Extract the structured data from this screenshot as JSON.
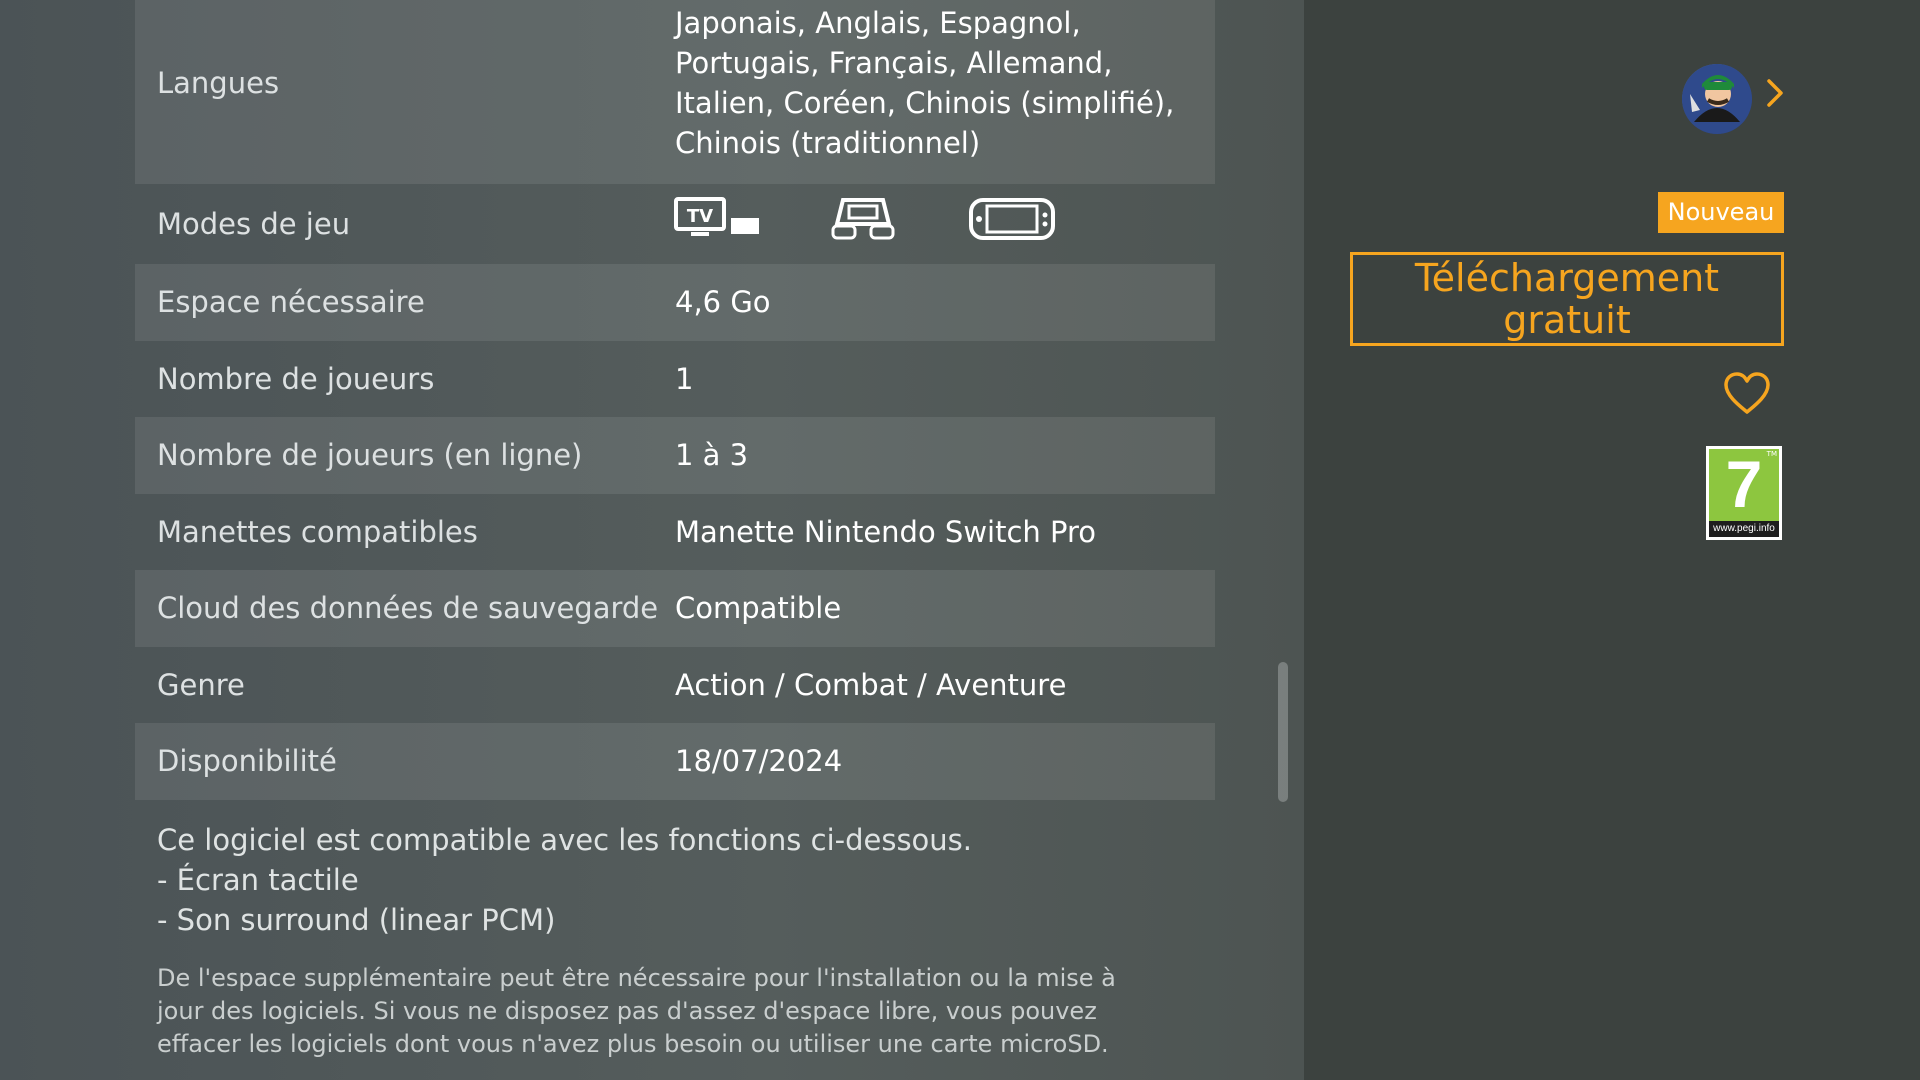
{
  "details": {
    "langues": {
      "label": "Langues",
      "lines": [
        "Japonais, Anglais, Espagnol,",
        "Portugais, Français, Allemand,",
        "Italien, Coréen, Chinois (simplifié),",
        "Chinois (traditionnel)"
      ]
    },
    "modes": {
      "label": "Modes de jeu",
      "icons": [
        "tv-mode-icon",
        "tabletop-mode-icon",
        "handheld-mode-icon"
      ],
      "tv_text": "TV"
    },
    "rows": [
      {
        "label": "Espace nécessaire",
        "value": "4,6 Go"
      },
      {
        "label": "Nombre de joueurs",
        "value": "1"
      },
      {
        "label": "Nombre de joueurs (en ligne)",
        "value": "1 à 3"
      },
      {
        "label": "Manettes compatibles",
        "value": "Manette Nintendo Switch Pro"
      },
      {
        "label": "Cloud des données de sauvegarde",
        "value": "Compatible"
      },
      {
        "label": "Genre",
        "value": "Action / Combat / Aventure"
      },
      {
        "label": "Disponibilité",
        "value": "18/07/2024"
      }
    ]
  },
  "features": {
    "intro": "Ce logiciel est compatible avec les fonctions ci-dessous.",
    "items": [
      "- Écran tactile",
      "- Son surround (linear PCM)"
    ]
  },
  "disclaimer": "De l'espace supplémentaire peut être nécessaire pour l'installation ou la mise à jour des logiciels. Si vous ne disposez pas d'assez d'espace libre, vous pouvez effacer les logiciels dont vous n'avez plus besoin ou utiliser une carte microSD.",
  "sidebar": {
    "badge": "Nouveau",
    "download_label": "Téléchargement\ngratuit",
    "rating": {
      "number": "7",
      "url": "www.pegi.info",
      "tm": "TM"
    }
  },
  "colors": {
    "accent": "#f6a51f",
    "pegi_green": "#8dc63f"
  }
}
